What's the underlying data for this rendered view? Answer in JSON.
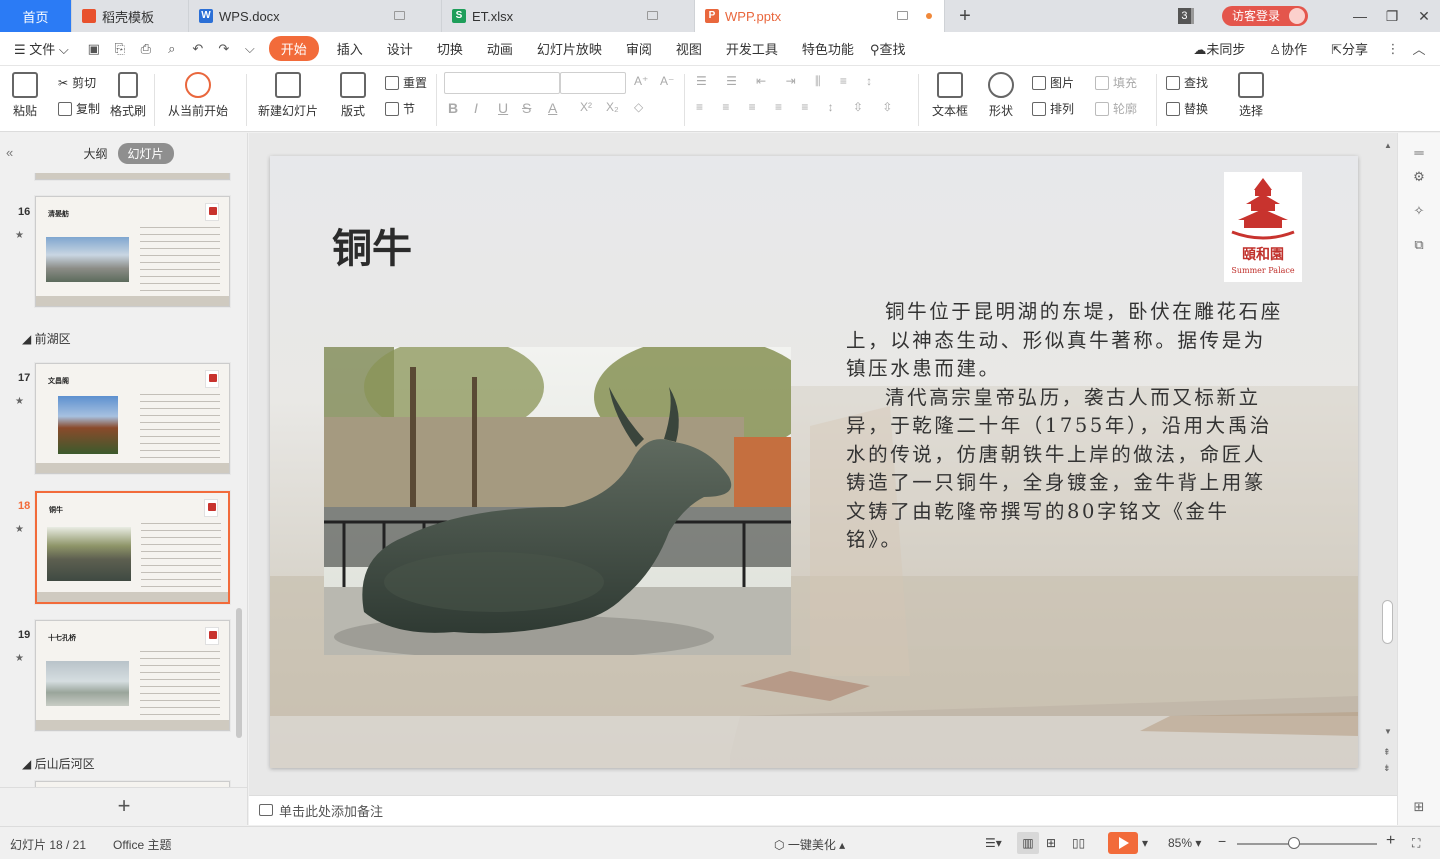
{
  "tabs": {
    "home": "首页",
    "template": "稻壳模板",
    "wps": "WPS.docx",
    "et": "ET.xlsx",
    "wpp": "WPP.pptx",
    "new_tab": "+",
    "count_badge": "3",
    "login": "访客登录"
  },
  "menu": {
    "file": "文件",
    "items": [
      "开始",
      "插入",
      "设计",
      "切换",
      "动画",
      "幻灯片放映",
      "审阅",
      "视图",
      "开发工具",
      "特色功能"
    ],
    "search": "查找",
    "unsynced": "未同步",
    "collab": "协作",
    "share": "分享"
  },
  "ribbon": {
    "paste": "粘贴",
    "cut": "剪切",
    "copy": "复制",
    "format_painter": "格式刷",
    "from_current": "从当前开始",
    "new_slide": "新建幻灯片",
    "layout": "版式",
    "reset": "重置",
    "section": "节",
    "textbox": "文本框",
    "shape": "形状",
    "picture": "图片",
    "fill": "填充",
    "arrange": "排列",
    "outline": "轮廓",
    "find": "查找",
    "replace": "替换",
    "select": "选择",
    "font_buttons": [
      "B",
      "I",
      "U",
      "S",
      "A",
      "X²",
      "X₂",
      "◇"
    ],
    "grow": "A⁺",
    "shrink": "A⁻"
  },
  "left_panel": {
    "outline_tab": "大纲",
    "slides_tab": "幻灯片",
    "sections": [
      "前湖区",
      "后山后河区"
    ],
    "slides": [
      {
        "num": "16",
        "title": "清晏舫"
      },
      {
        "num": "17",
        "title": "文昌阁"
      },
      {
        "num": "18",
        "title": "铜牛"
      },
      {
        "num": "19",
        "title": "十七孔桥"
      }
    ],
    "add": "+"
  },
  "slide": {
    "title": "铜牛",
    "logo_text": "頤和園",
    "logo_sub": "Summer Palace",
    "paragraphs": [
      "铜牛位于昆明湖的东堤，卧伏在雕花石座上，以神态生动、形似真牛著称。据传是为镇压水患而建。",
      "清代高宗皇帝弘历，袭古人而又标新立异，于乾隆二十年（1755年），沿用大禹治水的传说，仿唐朝铁牛上岸的做法，命匠人铸造了一只铜牛，全身镀金，金牛背上用篆文铸了由乾隆帝撰写的80字铭文《金牛铭》。"
    ]
  },
  "notes_placeholder": "单击此处添加备注",
  "status": {
    "slide_pos": "幻灯片 18 / 21",
    "theme": "Office 主题",
    "beautify": "一键美化",
    "zoom": "85%"
  },
  "colors": {
    "accent": "#f26b3a",
    "home_tab": "#2b7bf5",
    "login": "#e4564c",
    "logo_red": "#c0302b"
  }
}
